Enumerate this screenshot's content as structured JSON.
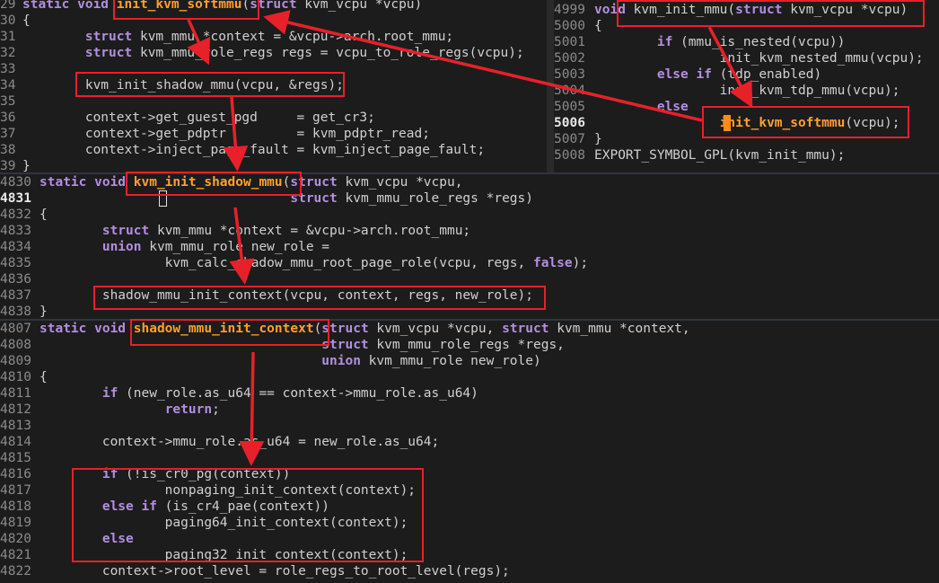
{
  "pane_top_left": {
    "lines": [
      {
        "num": "29",
        "segs": [
          [
            "kw",
            "static void "
          ],
          [
            "fn",
            "init_kvm_softmmu"
          ],
          [
            "code",
            "("
          ],
          [
            "kw",
            "struct"
          ],
          [
            "code",
            " kvm_vcpu *vcpu)"
          ]
        ]
      },
      {
        "num": "30",
        "segs": [
          [
            "code",
            "{"
          ]
        ]
      },
      {
        "num": "31",
        "segs": [
          [
            "code",
            "        "
          ],
          [
            "kw",
            "struct"
          ],
          [
            "code",
            " kvm_mmu *context = &vcpu->arch.root_mmu;"
          ]
        ]
      },
      {
        "num": "32",
        "segs": [
          [
            "code",
            "        "
          ],
          [
            "kw",
            "struct"
          ],
          [
            "code",
            " kvm_mmu_role_regs regs = vcpu_to_role_regs(vcpu);"
          ]
        ]
      },
      {
        "num": "33",
        "segs": []
      },
      {
        "num": "34",
        "segs": [
          [
            "code",
            "        kvm_init_shadow_mmu(vcpu, &regs);"
          ]
        ]
      },
      {
        "num": "35",
        "segs": []
      },
      {
        "num": "36",
        "segs": [
          [
            "code",
            "        context->get_guest_pgd     = get_cr3;"
          ]
        ]
      },
      {
        "num": "37",
        "segs": [
          [
            "code",
            "        context->get_pdptr         = kvm_pdptr_read;"
          ]
        ]
      },
      {
        "num": "38",
        "segs": [
          [
            "code",
            "        context->inject_page_fault = kvm_inject_page_fault;"
          ]
        ]
      },
      {
        "num": "39",
        "segs": [
          [
            "code",
            "}"
          ]
        ]
      }
    ]
  },
  "pane_top_right": {
    "lines": [
      {
        "num": "4999",
        "segs": [
          [
            "kw",
            "void"
          ],
          [
            "code",
            " kvm_init_mmu("
          ],
          [
            "kw",
            "struct"
          ],
          [
            "code",
            " kvm_vcpu *vcpu)"
          ]
        ]
      },
      {
        "num": "5000",
        "segs": [
          [
            "code",
            "{"
          ]
        ]
      },
      {
        "num": "5001",
        "segs": [
          [
            "code",
            "        "
          ],
          [
            "kw",
            "if"
          ],
          [
            "code",
            " (mmu_is_nested(vcpu))"
          ]
        ]
      },
      {
        "num": "5002",
        "segs": [
          [
            "code",
            "                init_kvm_nested_mmu(vcpu);"
          ]
        ]
      },
      {
        "num": "5003",
        "segs": [
          [
            "code",
            "        "
          ],
          [
            "kw",
            "else if"
          ],
          [
            "code",
            " (tdp_enabled)"
          ]
        ]
      },
      {
        "num": "5004",
        "segs": [
          [
            "code",
            "                init_kvm_tdp_mmu(vcpu);"
          ]
        ]
      },
      {
        "num": "5005",
        "segs": [
          [
            "code",
            "        "
          ],
          [
            "kw",
            "else"
          ]
        ]
      },
      {
        "num": "5006",
        "segs": [
          [
            "code",
            "                "
          ],
          [
            "fn",
            "init_kvm_softmmu"
          ],
          [
            "code",
            "(vcpu);"
          ]
        ]
      },
      {
        "num": "5007",
        "segs": [
          [
            "code",
            "}"
          ]
        ]
      },
      {
        "num": "5008",
        "segs": [
          [
            "code",
            "EXPORT_SYMBOL_GPL(kvm_init_mmu);"
          ]
        ]
      }
    ]
  },
  "pane_middle": {
    "lines": [
      {
        "num": "4830",
        "segs": [
          [
            "kw",
            "static void "
          ],
          [
            "fn",
            "kvm_init_shadow_mmu"
          ],
          [
            "code",
            "("
          ],
          [
            "kw",
            "struct"
          ],
          [
            "code",
            " kvm_vcpu *vcpu,"
          ]
        ]
      },
      {
        "num": "4831",
        "segs": [
          [
            "code",
            "                                "
          ],
          [
            "kw",
            "struct"
          ],
          [
            "code",
            " kvm_mmu_role_regs *regs)"
          ]
        ]
      },
      {
        "num": "4832",
        "segs": [
          [
            "code",
            "{"
          ]
        ]
      },
      {
        "num": "4833",
        "segs": [
          [
            "code",
            "        "
          ],
          [
            "kw",
            "struct"
          ],
          [
            "code",
            " kvm_mmu *context = &vcpu->arch.root_mmu;"
          ]
        ]
      },
      {
        "num": "4834",
        "segs": [
          [
            "code",
            "        "
          ],
          [
            "kw",
            "union"
          ],
          [
            "code",
            " kvm_mmu_role new_role ="
          ]
        ]
      },
      {
        "num": "4835",
        "segs": [
          [
            "code",
            "                kvm_calc_shadow_mmu_root_page_role(vcpu, regs, "
          ],
          [
            "kw",
            "false"
          ],
          [
            "code",
            ");"
          ]
        ]
      },
      {
        "num": "4836",
        "segs": []
      },
      {
        "num": "4837",
        "segs": [
          [
            "code",
            "        shadow_mmu_init_context(vcpu, context, regs, new_role);"
          ]
        ]
      },
      {
        "num": "4838",
        "segs": [
          [
            "code",
            "}"
          ]
        ]
      }
    ]
  },
  "pane_bottom": {
    "lines": [
      {
        "num": "4807",
        "segs": [
          [
            "kw",
            "static void "
          ],
          [
            "fn",
            "shadow_mmu_init_context"
          ],
          [
            "code",
            "("
          ],
          [
            "kw",
            "struct"
          ],
          [
            "code",
            " kvm_vcpu *vcpu, "
          ],
          [
            "kw",
            "struct"
          ],
          [
            "code",
            " kvm_mmu *context,"
          ]
        ]
      },
      {
        "num": "4808",
        "segs": [
          [
            "code",
            "                                    "
          ],
          [
            "kw",
            "struct"
          ],
          [
            "code",
            " kvm_mmu_role_regs *regs,"
          ]
        ]
      },
      {
        "num": "4809",
        "segs": [
          [
            "code",
            "                                    "
          ],
          [
            "kw",
            "union"
          ],
          [
            "code",
            " kvm_mmu_role new_role)"
          ]
        ]
      },
      {
        "num": "4810",
        "segs": [
          [
            "code",
            "{"
          ]
        ]
      },
      {
        "num": "4811",
        "segs": [
          [
            "code",
            "        "
          ],
          [
            "kw",
            "if"
          ],
          [
            "code",
            " (new_role.as_u64 == context->mmu_role.as_u64)"
          ]
        ]
      },
      {
        "num": "4812",
        "segs": [
          [
            "code",
            "                "
          ],
          [
            "kw",
            "return"
          ],
          [
            "code",
            ";"
          ]
        ]
      },
      {
        "num": "4813",
        "segs": []
      },
      {
        "num": "4814",
        "segs": [
          [
            "code",
            "        context->mmu_role.as_u64 = new_role.as_u64;"
          ]
        ]
      },
      {
        "num": "4815",
        "segs": []
      },
      {
        "num": "4816",
        "segs": [
          [
            "code",
            "        "
          ],
          [
            "kw",
            "if"
          ],
          [
            "code",
            " (!is_cr0_pg(context))"
          ]
        ]
      },
      {
        "num": "4817",
        "segs": [
          [
            "code",
            "                nonpaging_init_context(context);"
          ]
        ]
      },
      {
        "num": "4818",
        "segs": [
          [
            "code",
            "        "
          ],
          [
            "kw",
            "else if"
          ],
          [
            "code",
            " (is_cr4_pae(context))"
          ]
        ]
      },
      {
        "num": "4819",
        "segs": [
          [
            "code",
            "                paging64_init_context(context);"
          ]
        ]
      },
      {
        "num": "4820",
        "segs": [
          [
            "code",
            "        "
          ],
          [
            "kw",
            "else"
          ]
        ]
      },
      {
        "num": "4821",
        "segs": [
          [
            "code",
            "                paging32_init_context(context);"
          ]
        ]
      },
      {
        "num": "4822",
        "segs": [
          [
            "code",
            "        context->root_level = role_regs_to_root_level(regs);"
          ]
        ]
      }
    ]
  },
  "colors": {
    "background": "#1c1c1c",
    "keyword": "#b48ee0",
    "function_highlight": "#ffa030",
    "annotation": "#e8202a"
  }
}
